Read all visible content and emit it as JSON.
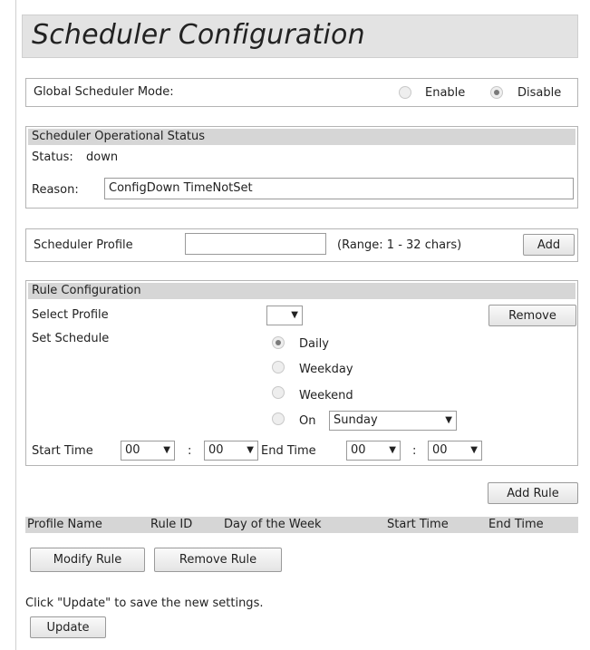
{
  "page": {
    "title": "Scheduler Configuration"
  },
  "global": {
    "label": "Global Scheduler Mode:",
    "options": [
      "Enable",
      "Disable"
    ],
    "selected": "Disable"
  },
  "operational": {
    "header": "Scheduler Operational Status",
    "status_label": "Status:",
    "status_value": "down",
    "reason_label": "Reason:",
    "reason_value": "ConfigDown  TimeNotSet"
  },
  "profile": {
    "label": "Scheduler Profile",
    "value": "",
    "range": "(Range: 1 - 32 chars)",
    "add_label": "Add"
  },
  "rule": {
    "header": "Rule Configuration",
    "select_profile_label": "Select Profile",
    "select_profile_value": "",
    "remove_label": "Remove",
    "set_schedule_label": "Set Schedule",
    "schedule_options": [
      "Daily",
      "Weekday",
      "Weekend",
      "On"
    ],
    "schedule_selected": "Daily",
    "on_day": "Sunday",
    "start_time_label": "Start Time",
    "start_hour": "00",
    "start_minute": "00",
    "colon": ":",
    "end_time_label": "End Time",
    "end_hour": "00",
    "end_minute": "00"
  },
  "rules_table": {
    "add_rule_label": "Add Rule",
    "columns": [
      "Profile Name",
      "Rule ID",
      "Day of the Week",
      "Start Time",
      "End Time"
    ],
    "rows": [],
    "modify_label": "Modify Rule",
    "remove_label": "Remove Rule"
  },
  "footer": {
    "note": "Click \"Update\" to save the new settings.",
    "update_label": "Update"
  }
}
